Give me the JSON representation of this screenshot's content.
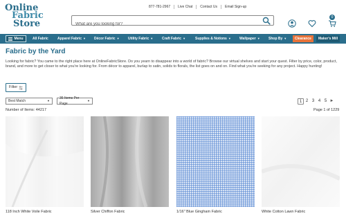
{
  "logo": {
    "line1": "Online",
    "line2": "Fabric",
    "line3": "Store"
  },
  "utility": {
    "phone": "877-781-2967",
    "live_chat": "Live Chat",
    "contact": "Contact Us",
    "signup": "Email Sign-up"
  },
  "search": {
    "placeholder": "What are you looking for?"
  },
  "cart": {
    "count": "0"
  },
  "nav": {
    "menu_label": "Menu",
    "items": [
      "All Fabric",
      "Apparel Fabric",
      "Décor Fabric",
      "Utility Fabric",
      "Craft Fabric",
      "Supplies & Notions",
      "Wallpaper",
      "Shop By"
    ],
    "clearance": "Clearance",
    "makers_mill": "Maker's Mill"
  },
  "page": {
    "title": "Fabric by the Yard",
    "intro": "Looking for fabric? You came to the right place here at OnlineFabricStore. Do you yearn to disappear into a world of fabric? Browse our virtual shelves and start your quest. Filter by price, color, product, brand, and more to get closer to what you're looking for. From décor to apparel, burlap to satin, solids to florals, the list goes on and on. Find what you're seeking for any project. Happy hunting!",
    "filter_label": "Filter"
  },
  "controls": {
    "sort_value": "Best Match",
    "per_page_value": "36 Items Per Page",
    "pages": [
      "1",
      "2",
      "3",
      "4",
      "5"
    ],
    "current_page": "1",
    "next_symbol": "►",
    "item_count": "Number of Items: 44217",
    "page_of": "Page 1 of 1229"
  },
  "products": [
    {
      "name": "118 Inch White Voile Fabric"
    },
    {
      "name": "Silver Chiffon Fabric"
    },
    {
      "name": "1/16\" Blue Gingham Fabric"
    },
    {
      "name": "White Cotton Lawn Fabric"
    }
  ],
  "colors": {
    "brand": "#2a6e8c",
    "clearance": "#e8733a",
    "gingham": "#4a7fd0"
  }
}
